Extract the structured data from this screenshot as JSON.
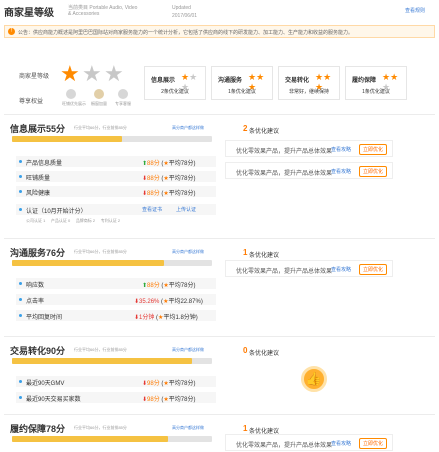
{
  "header": {
    "title": "商家星等级",
    "subtitle": "当前类目 Portable Audio, Video & Accessories",
    "updated_label": "Updated",
    "updated_date": "2017/06/01",
    "rules_link": "查看规则"
  },
  "notice": {
    "text": "公告：供应商能力概述是阿里巴巴国际站对商家服务能力的一个统计分析，它包括了供应商的线下的研发能力、加工能力、生产能力和收益的服务能力。"
  },
  "summary": {
    "star_label": "商家星等级",
    "stars_on": 1,
    "stars_total": 3,
    "rights_label": "尊享权益",
    "rights": [
      "旺铺优先展示",
      "橱窗加量",
      "专享客服"
    ],
    "cards": [
      {
        "title": "信息展示",
        "stars_on": 1,
        "sub": "2条优化建议"
      },
      {
        "title": "沟通服务",
        "stars_on": 3,
        "sub": "1条优化建议"
      },
      {
        "title": "交易转化",
        "stars_on": 3,
        "sub": "非常好，继续保持"
      },
      {
        "title": "履约保障",
        "stars_on": 2,
        "sub": "1条优化建议"
      }
    ]
  },
  "sections": [
    {
      "title": "信息展示55分",
      "meta": "行业平均66分，行业前排85分",
      "link": "高分商户都这样做",
      "score": 55,
      "metrics": [
        {
          "name": "产品信息质量",
          "trend": "up",
          "value": "88分",
          "avg": "平均78分"
        },
        {
          "name": "旺铺质量",
          "trend": "down",
          "value": "88分",
          "avg": "平均78分"
        },
        {
          "name": "风险健康",
          "trend": "down",
          "value": "88分",
          "avg": "平均78分"
        },
        {
          "name": "认证（10月开始计分）",
          "trend": "",
          "value": "查看证书",
          "avg": "上传认证"
        }
      ],
      "cert_items": [
        "公司认证 1",
        "产品认证 0",
        "品牌商标 2",
        "专利认证 2"
      ],
      "suggestion_count": "2",
      "suggestion_label": "条优化建议",
      "suggestions": [
        {
          "text": "优化零效果产品，提升产品总体效果",
          "view": "查看攻略",
          "button": "立即优化"
        },
        {
          "text": "优化零效果产品，提升产品总体效果",
          "view": "查看攻略",
          "button": "立即优化"
        }
      ]
    },
    {
      "title": "沟通服务76分",
      "meta": "行业平均66分，行业前排85分",
      "link": "高分商户都这样做",
      "score": 76,
      "metrics": [
        {
          "name": "响应数",
          "trend": "up",
          "value": "88分",
          "avg": "平均78分"
        },
        {
          "name": "点击率",
          "trend": "down",
          "value": "35.26%",
          "avg": "平均22.87%"
        },
        {
          "name": "平均回复时间",
          "trend": "down",
          "value": "1分钟",
          "avg": "平均1.8分钟"
        }
      ],
      "suggestion_count": "1",
      "suggestion_label": "条优化建议",
      "suggestions": [
        {
          "text": "优化零效果产品，提升产品总体效果",
          "view": "查看攻略",
          "button": "立即优化"
        }
      ]
    },
    {
      "title": "交易转化90分",
      "meta": "行业平均66分，行业前排85分",
      "link": "高分商户都这样做",
      "score": 90,
      "metrics": [
        {
          "name": "最近90天GMV",
          "trend": "down",
          "value": "98分",
          "avg": "平均78分"
        },
        {
          "name": "最近90天交易买家数",
          "trend": "down",
          "value": "98分",
          "avg": "平均78分"
        }
      ],
      "suggestion_count": "0",
      "suggestion_label": "条优化建议"
    },
    {
      "title": "履约保障78分",
      "meta": "行业平均66分，行业前排85分",
      "link": "高分商户都这样做",
      "score": 78,
      "suggestion_count": "1",
      "suggestion_label": "条优化建议",
      "suggestions": [
        {
          "text": "优化零效果产品，提升产品总体效果",
          "view": "查看攻略",
          "button": "立即优化"
        }
      ]
    }
  ],
  "colors": {
    "accent": "#ff8a00",
    "bar": "#f5c242",
    "up": "#2eaa3c",
    "down": "#e53935",
    "link": "#3a7bd5"
  }
}
